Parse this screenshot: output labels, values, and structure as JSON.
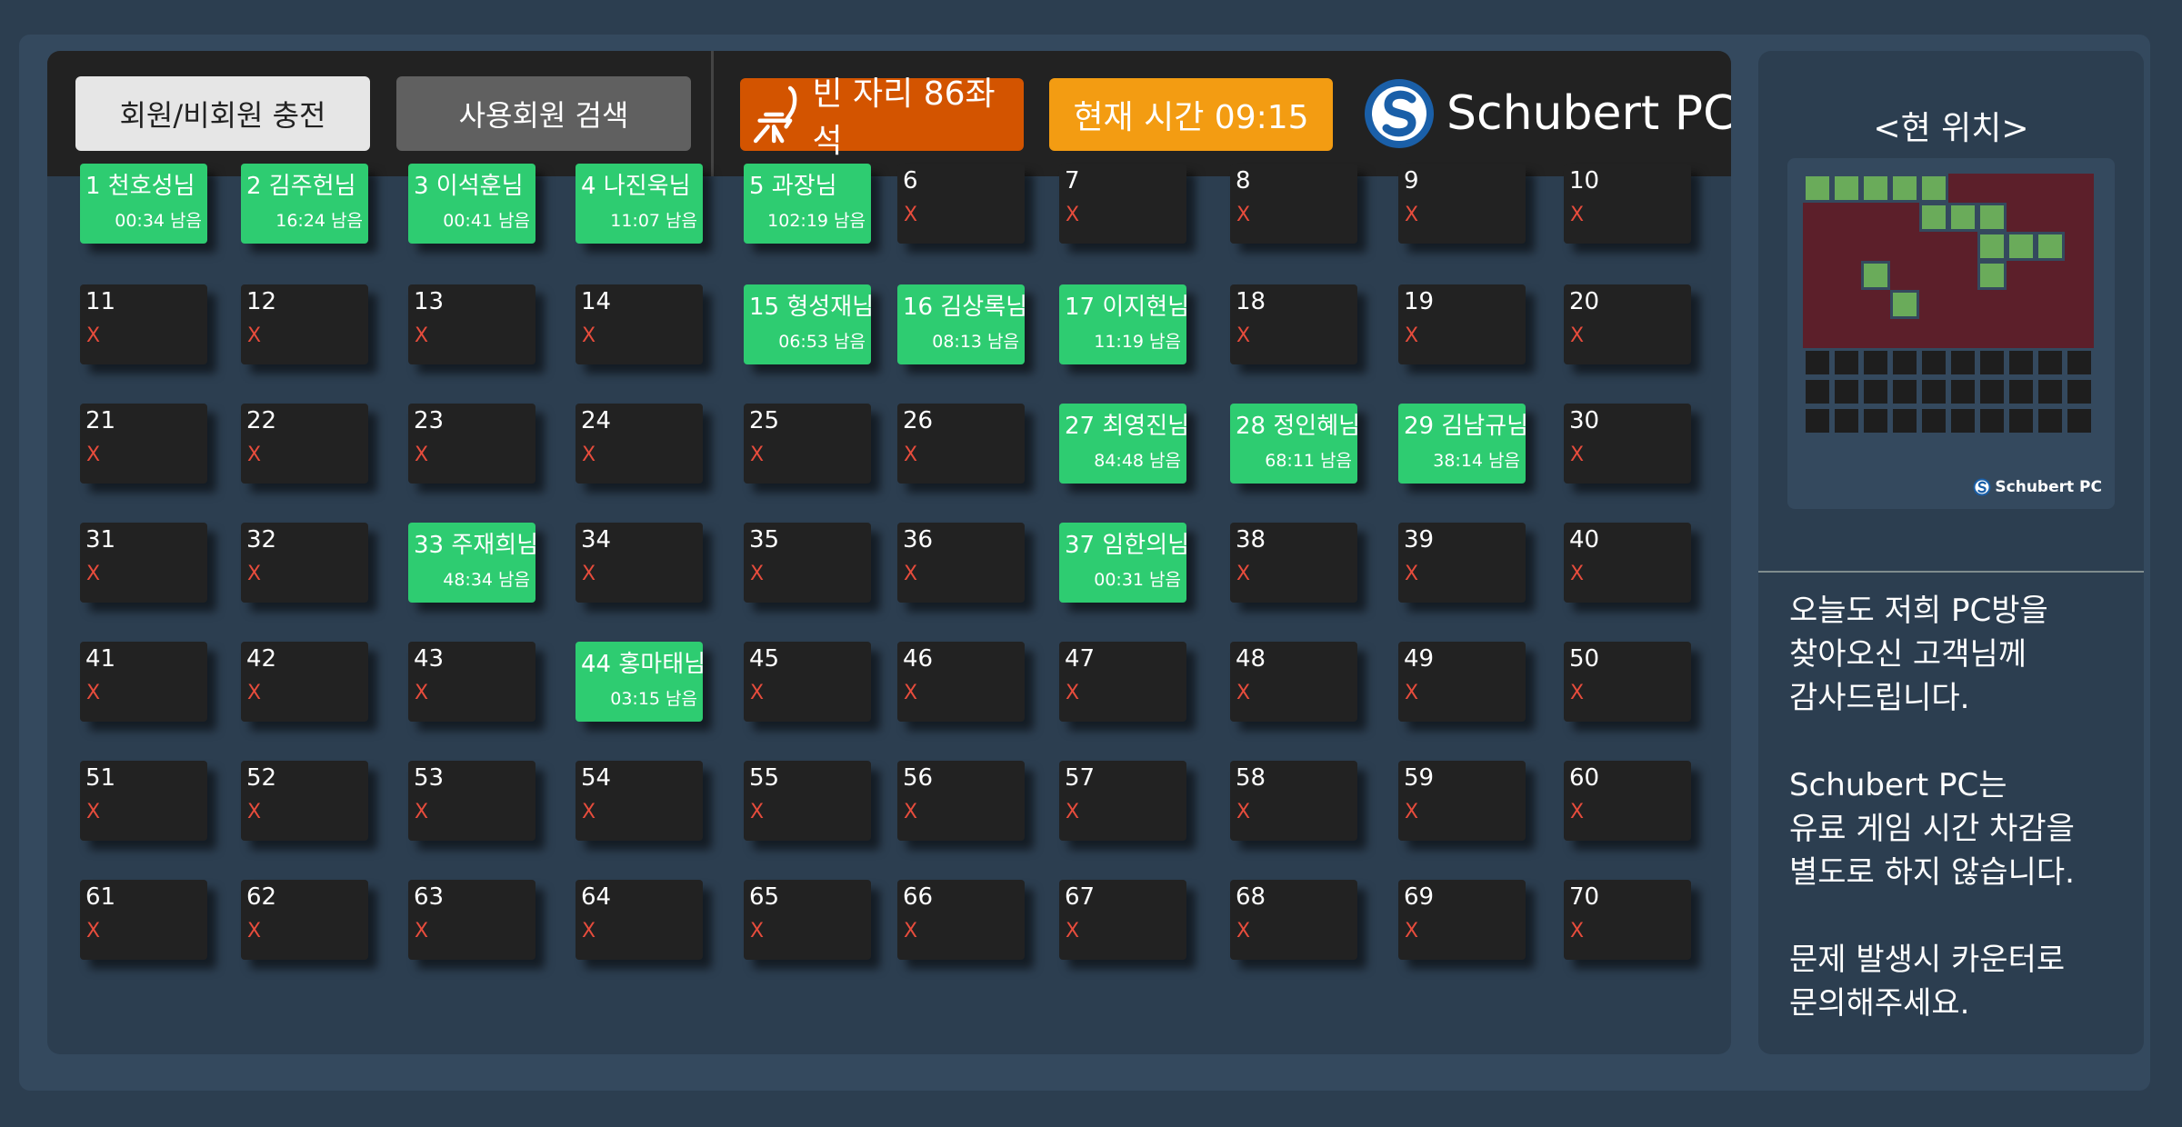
{
  "header": {
    "charge_button": "회원/비회원 충전",
    "search_button": "사용회원 검색",
    "empty_seats": "빈 자리 86좌석",
    "current_time": "현재 시간 09:15",
    "brand_name": "Schubert PC"
  },
  "seats": [
    {
      "title": "1  천호성님",
      "status": "occupied",
      "time": "00:34 남음"
    },
    {
      "title": "2  김주헌님",
      "status": "occupied",
      "time": "16:24 남음"
    },
    {
      "title": "3  이석훈님",
      "status": "occupied",
      "time": "00:41 남음"
    },
    {
      "title": "4  나진욱님",
      "status": "occupied",
      "time": "11:07 남음"
    },
    {
      "title": "5     과장님",
      "status": "occupied",
      "time": "102:19 남음"
    },
    {
      "title": "6",
      "status": "empty",
      "mark": "X"
    },
    {
      "title": "7",
      "status": "empty",
      "mark": "X"
    },
    {
      "title": "8",
      "status": "empty",
      "mark": "X"
    },
    {
      "title": "9",
      "status": "empty",
      "mark": "X"
    },
    {
      "title": "10",
      "status": "empty",
      "mark": "X"
    },
    {
      "title": "11",
      "status": "empty",
      "mark": "X"
    },
    {
      "title": "12",
      "status": "empty",
      "mark": "X"
    },
    {
      "title": "13",
      "status": "empty",
      "mark": "X"
    },
    {
      "title": "14",
      "status": "empty",
      "mark": "X"
    },
    {
      "title": "15 형성재님",
      "status": "occupied",
      "time": "06:53 남음"
    },
    {
      "title": "16 김상록님",
      "status": "occupied",
      "time": "08:13 남음"
    },
    {
      "title": "17 이지현님",
      "status": "occupied",
      "time": "11:19 남음"
    },
    {
      "title": "18",
      "status": "empty",
      "mark": "X"
    },
    {
      "title": "19",
      "status": "empty",
      "mark": "X"
    },
    {
      "title": "20",
      "status": "empty",
      "mark": "X"
    },
    {
      "title": "21",
      "status": "empty",
      "mark": "X"
    },
    {
      "title": "22",
      "status": "empty",
      "mark": "X"
    },
    {
      "title": "23",
      "status": "empty",
      "mark": "X"
    },
    {
      "title": "24",
      "status": "empty",
      "mark": "X"
    },
    {
      "title": "25",
      "status": "empty",
      "mark": "X"
    },
    {
      "title": "26",
      "status": "empty",
      "mark": "X"
    },
    {
      "title": "27 최영진님",
      "status": "occupied",
      "time": "84:48 남음"
    },
    {
      "title": "28 정인혜님",
      "status": "occupied",
      "time": "68:11 남음"
    },
    {
      "title": "29 김남규님",
      "status": "occupied",
      "time": "38:14 남음"
    },
    {
      "title": "30",
      "status": "empty",
      "mark": "X"
    },
    {
      "title": "31",
      "status": "empty",
      "mark": "X"
    },
    {
      "title": "32",
      "status": "empty",
      "mark": "X"
    },
    {
      "title": "33 주재희님",
      "status": "occupied",
      "time": "48:34 남음"
    },
    {
      "title": "34",
      "status": "empty",
      "mark": "X"
    },
    {
      "title": "35",
      "status": "empty",
      "mark": "X"
    },
    {
      "title": "36",
      "status": "empty",
      "mark": "X"
    },
    {
      "title": "37 임한의님",
      "status": "occupied",
      "time": "00:31 남음"
    },
    {
      "title": "38",
      "status": "empty",
      "mark": "X"
    },
    {
      "title": "39",
      "status": "empty",
      "mark": "X"
    },
    {
      "title": "40",
      "status": "empty",
      "mark": "X"
    },
    {
      "title": "41",
      "status": "empty",
      "mark": "X"
    },
    {
      "title": "42",
      "status": "empty",
      "mark": "X"
    },
    {
      "title": "43",
      "status": "empty",
      "mark": "X"
    },
    {
      "title": "44 홍마태님",
      "status": "occupied",
      "time": "03:15 남음"
    },
    {
      "title": "45",
      "status": "empty",
      "mark": "X"
    },
    {
      "title": "46",
      "status": "empty",
      "mark": "X"
    },
    {
      "title": "47",
      "status": "empty",
      "mark": "X"
    },
    {
      "title": "48",
      "status": "empty",
      "mark": "X"
    },
    {
      "title": "49",
      "status": "empty",
      "mark": "X"
    },
    {
      "title": "50",
      "status": "empty",
      "mark": "X"
    },
    {
      "title": "51",
      "status": "empty",
      "mark": "X"
    },
    {
      "title": "52",
      "status": "empty",
      "mark": "X"
    },
    {
      "title": "53",
      "status": "empty",
      "mark": "X"
    },
    {
      "title": "54",
      "status": "empty",
      "mark": "X"
    },
    {
      "title": "55",
      "status": "empty",
      "mark": "X"
    },
    {
      "title": "56",
      "status": "empty",
      "mark": "X"
    },
    {
      "title": "57",
      "status": "empty",
      "mark": "X"
    },
    {
      "title": "58",
      "status": "empty",
      "mark": "X"
    },
    {
      "title": "59",
      "status": "empty",
      "mark": "X"
    },
    {
      "title": "60",
      "status": "empty",
      "mark": "X"
    },
    {
      "title": "61",
      "status": "empty",
      "mark": "X"
    },
    {
      "title": "62",
      "status": "empty",
      "mark": "X"
    },
    {
      "title": "63",
      "status": "empty",
      "mark": "X"
    },
    {
      "title": "64",
      "status": "empty",
      "mark": "X"
    },
    {
      "title": "65",
      "status": "empty",
      "mark": "X"
    },
    {
      "title": "66",
      "status": "empty",
      "mark": "X"
    },
    {
      "title": "67",
      "status": "empty",
      "mark": "X"
    },
    {
      "title": "68",
      "status": "empty",
      "mark": "X"
    },
    {
      "title": "69",
      "status": "empty",
      "mark": "X"
    },
    {
      "title": "70",
      "status": "empty",
      "mark": "X"
    }
  ],
  "sidebar": {
    "location_title": "<현 위치>",
    "minimap_brand": "Schubert PC",
    "minimap_rows": [
      "GGGGGRRRRR",
      "RRRRGGGRRR",
      "RRRRRRGGGR",
      "RRGRRRGRRR",
      "RRRGRRRRRR",
      "RRRRRRRRRR",
      "DDDDDDDDDD",
      "DDDDDDDDDD",
      "DDDDDDDDDD"
    ],
    "minimap_colors": {
      "G": "#6aab5a",
      "R": "#5c1f2a",
      "D": "#1e1e1e"
    },
    "notices": [
      "오늘도 저희 PC방을\n찾아오신 고객님께\n감사드립니다.",
      "Schubert PC는\n유료 게임 시간 차감을\n별도로 하지 않습니다.",
      "문제 발생시 카운터로\n문의해주세요."
    ]
  },
  "colors": {
    "occupied_seat": "#2ecc71",
    "empty_seat": "#222222",
    "empty_mark": "#e74c3c",
    "empty_badge": "#d35400",
    "time_badge": "#f39c12",
    "brand_blue": "#1a5fa8"
  },
  "icons": [
    "chair-icon",
    "schubert-logo-icon"
  ]
}
